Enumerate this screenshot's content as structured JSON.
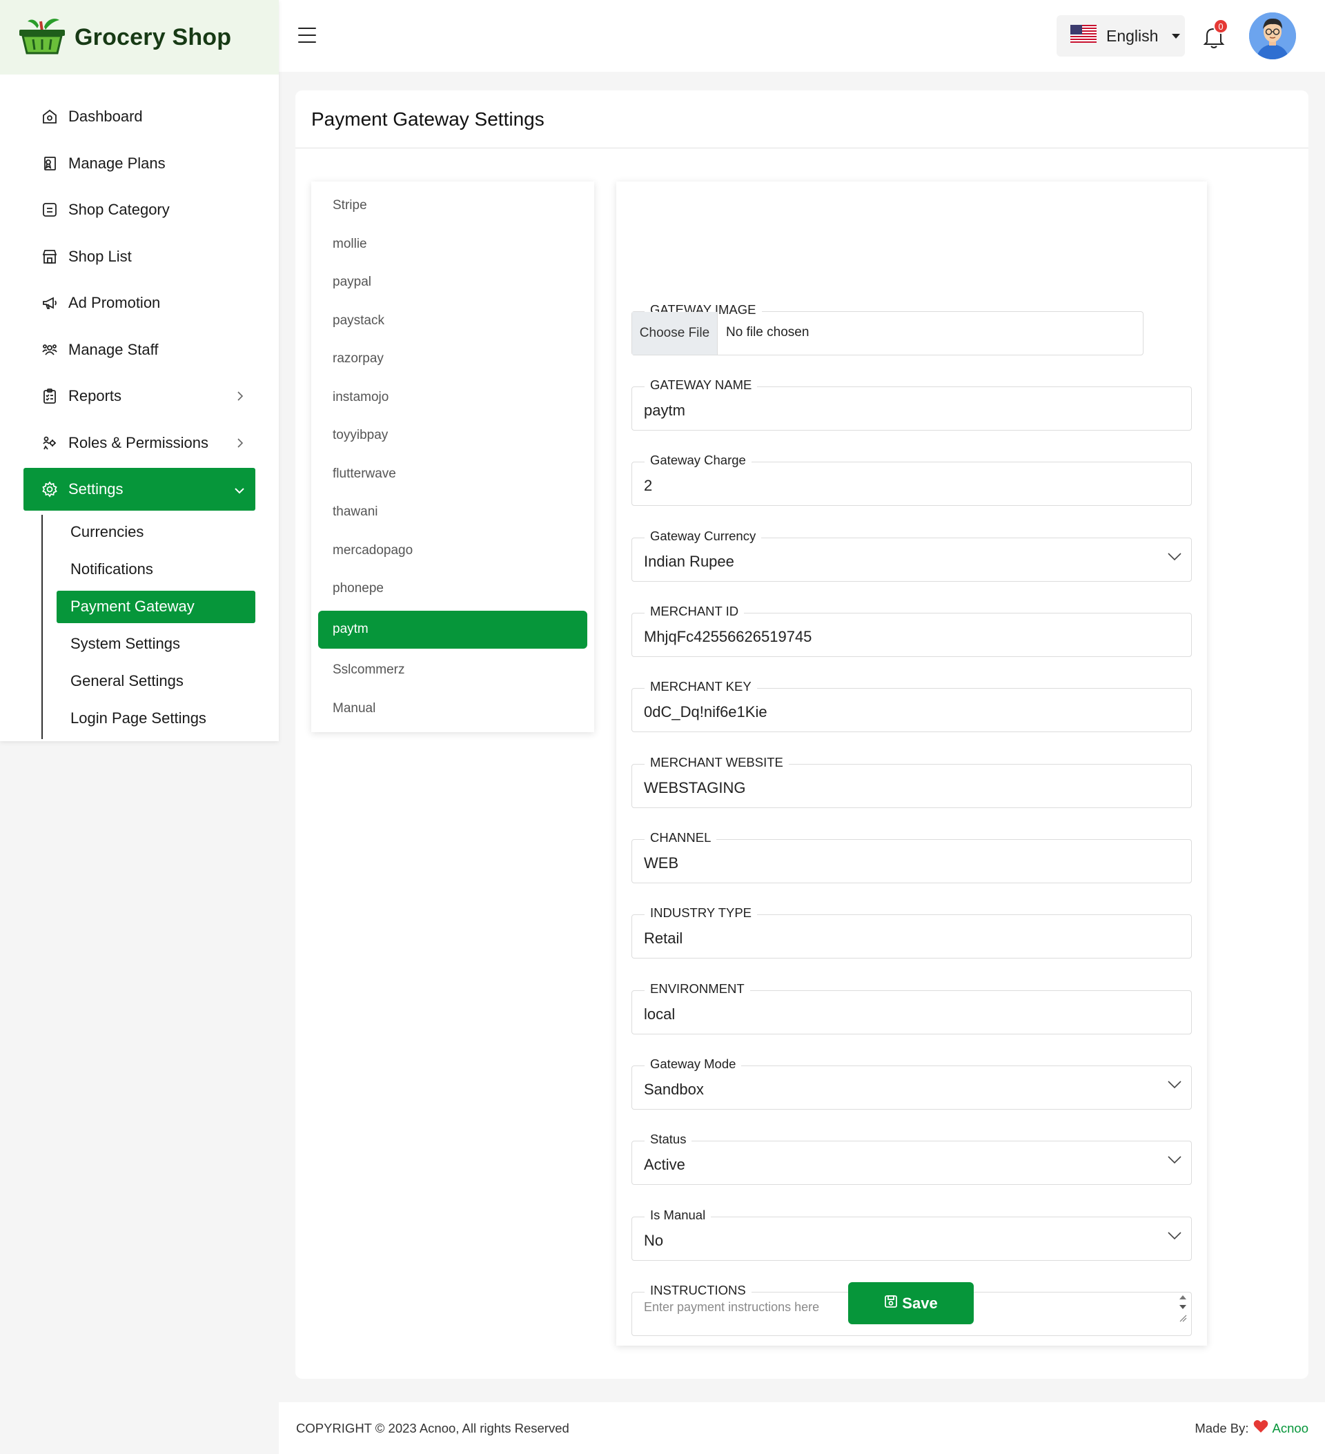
{
  "brand": {
    "name": "Grocery Shop"
  },
  "header": {
    "language": "English",
    "notification_count": "0"
  },
  "sidebar": {
    "items": [
      {
        "label": "Dashboard",
        "icon": "home-icon"
      },
      {
        "label": "Manage Plans",
        "icon": "plans-icon"
      },
      {
        "label": "Shop Category",
        "icon": "category-icon"
      },
      {
        "label": "Shop List",
        "icon": "shop-icon"
      },
      {
        "label": "Ad Promotion",
        "icon": "megaphone-icon"
      },
      {
        "label": "Manage Staff",
        "icon": "staff-icon"
      },
      {
        "label": "Reports",
        "icon": "reports-icon"
      },
      {
        "label": "Roles & Permissions",
        "icon": "roles-icon"
      },
      {
        "label": "Settings",
        "icon": "gear-icon"
      }
    ],
    "settings_sub": [
      "Currencies",
      "Notifications",
      "Payment Gateway",
      "System Settings",
      "General Settings",
      "Login Page Settings"
    ]
  },
  "page": {
    "title": "Payment Gateway Settings"
  },
  "gateways": [
    "Stripe",
    "mollie",
    "paypal",
    "paystack",
    "razorpay",
    "instamojo",
    "toyyibpay",
    "flutterwave",
    "thawani",
    "mercadopago",
    "phonepe",
    "paytm",
    "Sslcommerz",
    "Manual"
  ],
  "form": {
    "image_label": "GATEWAY IMAGE",
    "choose_file": "Choose File",
    "no_file": "No file chosen",
    "name_label": "GATEWAY NAME",
    "name_value": "paytm",
    "charge_label": "Gateway Charge",
    "charge_value": "2",
    "currency_label": "Gateway Currency",
    "currency_value": "Indian Rupee",
    "merchant_id_label": "MERCHANT ID",
    "merchant_id_value": "MhjqFc42556626519745",
    "merchant_key_label": "MERCHANT KEY",
    "merchant_key_value": "0dC_Dq!nif6e1Kie",
    "merchant_website_label": "MERCHANT WEBSITE",
    "merchant_website_value": "WEBSTAGING",
    "channel_label": "CHANNEL",
    "channel_value": "WEB",
    "industry_label": "INDUSTRY TYPE",
    "industry_value": "Retail",
    "environment_label": "ENVIRONMENT",
    "environment_value": "local",
    "mode_label": "Gateway Mode",
    "mode_value": "Sandbox",
    "status_label": "Status",
    "status_value": "Active",
    "manual_label": "Is Manual",
    "manual_value": "No",
    "instructions_label": "INSTRUCTIONS",
    "instructions_placeholder": "Enter payment instructions here",
    "save_label": "Save"
  },
  "footer": {
    "copyright": "COPYRIGHT © 2023 Acnoo, All rights Reserved",
    "made_by": "Made By:",
    "made_brand": "Acnoo"
  },
  "colors": {
    "accent": "#06963a",
    "badge": "#e53935"
  }
}
